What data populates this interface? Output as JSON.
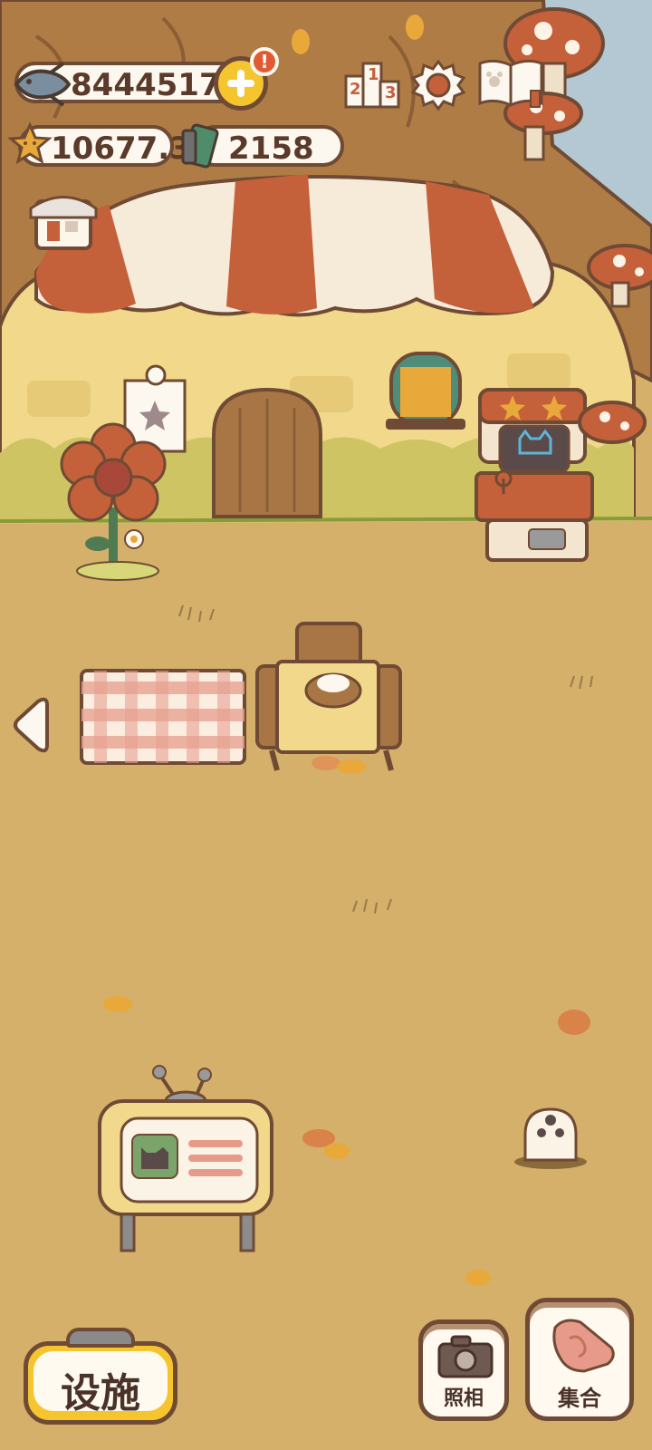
{
  "currency": {
    "fish": "8444517",
    "stars": "10677.3",
    "tickets": "2158"
  },
  "buttons": {
    "facilities": "设施",
    "camera": "照相",
    "gather": "集合"
  },
  "leaderboard": {
    "digits": [
      "2",
      "1",
      "3"
    ]
  },
  "badge": {
    "alert": "!"
  },
  "colors": {
    "ground": "#d4b06a",
    "awning_red": "#c4603a",
    "awning_cream": "#f6ead8",
    "outline": "#6f4a34",
    "accent_yellow": "#f5c530"
  }
}
